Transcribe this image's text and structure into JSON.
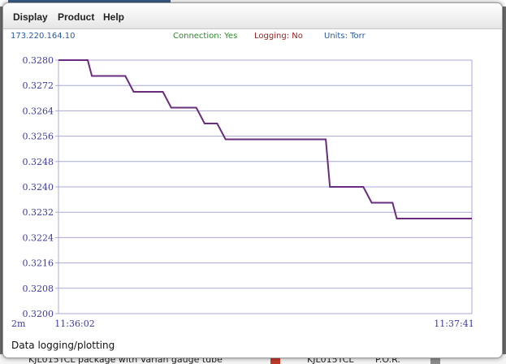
{
  "menu": {
    "items": [
      "Display",
      "Product",
      "Help"
    ]
  },
  "status": {
    "ip": "173.220.164.10",
    "connection": "Connection: Yes",
    "logging": "Logging: No",
    "units": "Units: Torr"
  },
  "footer": {
    "label": "Data logging/plotting"
  },
  "background": {
    "bottom_text_1": "KJL015TCL package with Varian gauge tube",
    "bottom_text_2": "KJL015TCL",
    "bottom_text_3": "P.O.R."
  },
  "colors": {
    "accent_line": "#6a2c7c",
    "grid": "#a8a8d8",
    "axis_text": "#3a3aa0",
    "connection": "#2a8a2a",
    "logging": "#a02020",
    "units": "#2a5aa0"
  },
  "chart_data": {
    "type": "line",
    "title": "",
    "xlabel": "",
    "ylabel": "",
    "x_tick_labels": [
      "2m",
      "11:36:02",
      "11:37:41"
    ],
    "y_tick_labels": [
      "0.3280",
      "0.3272",
      "0.3264",
      "0.3256",
      "0.3248",
      "0.3240",
      "0.3232",
      "0.3224",
      "0.3216",
      "0.3208",
      "0.3200"
    ],
    "ylim": [
      0.32,
      0.328
    ],
    "xlim": [
      "11:36:02",
      "11:37:41"
    ],
    "grid": true,
    "series": [
      {
        "x": [
          "11:36:02",
          "11:36:09",
          "11:36:10",
          "11:36:18",
          "11:36:20",
          "11:36:27",
          "11:36:29",
          "11:36:35",
          "11:36:37",
          "11:36:40",
          "11:36:42",
          "11:37:06",
          "11:37:07",
          "11:37:15",
          "11:37:17",
          "11:37:22",
          "11:37:23",
          "11:37:41"
        ],
        "values": [
          0.328,
          0.328,
          0.3275,
          0.3275,
          0.327,
          0.327,
          0.3265,
          0.3265,
          0.326,
          0.326,
          0.3255,
          0.3255,
          0.324,
          0.324,
          0.3235,
          0.3235,
          0.323,
          0.323
        ]
      }
    ]
  }
}
